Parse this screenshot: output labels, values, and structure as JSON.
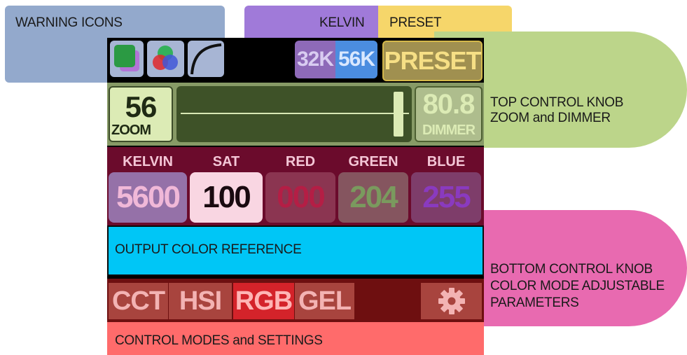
{
  "annotations": {
    "warning_icons": "WARNING ICONS",
    "kelvin": "KELVIN",
    "preset": "PRESET",
    "top_knob_line1": "TOP CONTROL KNOB",
    "top_knob_line2": "ZOOM and DIMMER",
    "bottom_knob_line1": "BOTTOM CONTROL KNOB",
    "bottom_knob_line2": "COLOR MODE ADJUSTABLE",
    "bottom_knob_line3": "PARAMETERS",
    "output_color_reference": "OUTPUT COLOR REFERENCE",
    "control_modes": "CONTROL MODES and SETTINGS"
  },
  "top_bar": {
    "warning_icons": [
      "color-gamut-icon",
      "rgb-mix-icon",
      "dimmer-curve-icon"
    ],
    "kelvin_buttons": [
      {
        "label": "32K",
        "value": "32",
        "unit": "K"
      },
      {
        "label": "56K",
        "value": "56",
        "unit": "K"
      }
    ],
    "preset_label": "PRESET"
  },
  "zoom_dimmer": {
    "zoom_value": "56",
    "zoom_label": "ZOOM",
    "dimmer_value": "80.8",
    "dimmer_label": "DIMMER"
  },
  "parameters": {
    "headers": [
      "KELVIN",
      "SAT",
      "RED",
      "GREEN",
      "BLUE"
    ],
    "values": [
      "5600",
      "100",
      "000",
      "204",
      "255"
    ]
  },
  "modes": {
    "buttons": [
      "CCT",
      "HSI",
      "RGB",
      "GEL"
    ],
    "active": "RGB",
    "settings_icon": "gear-icon"
  },
  "colors": {
    "warning_blue": "#93a9cc",
    "kelvin_purple": "#a07ad9",
    "preset_yellow": "#f6d66a",
    "top_knob_green": "#bcd58a",
    "bottom_knob_pink": "#e86ab0",
    "output_cyan": "#00c6f6",
    "control_red": "#ff6b6b"
  }
}
